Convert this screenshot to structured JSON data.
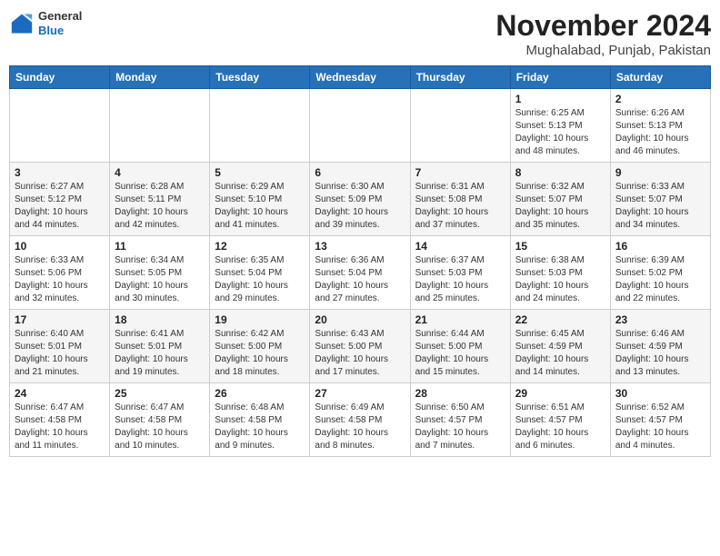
{
  "header": {
    "logo_line1": "General",
    "logo_line2": "Blue",
    "title": "November 2024",
    "subtitle": "Mughalabad, Punjab, Pakistan"
  },
  "days_of_week": [
    "Sunday",
    "Monday",
    "Tuesday",
    "Wednesday",
    "Thursday",
    "Friday",
    "Saturday"
  ],
  "weeks": [
    [
      {
        "day": "",
        "info": ""
      },
      {
        "day": "",
        "info": ""
      },
      {
        "day": "",
        "info": ""
      },
      {
        "day": "",
        "info": ""
      },
      {
        "day": "",
        "info": ""
      },
      {
        "day": "1",
        "info": "Sunrise: 6:25 AM\nSunset: 5:13 PM\nDaylight: 10 hours\nand 48 minutes."
      },
      {
        "day": "2",
        "info": "Sunrise: 6:26 AM\nSunset: 5:13 PM\nDaylight: 10 hours\nand 46 minutes."
      }
    ],
    [
      {
        "day": "3",
        "info": "Sunrise: 6:27 AM\nSunset: 5:12 PM\nDaylight: 10 hours\nand 44 minutes."
      },
      {
        "day": "4",
        "info": "Sunrise: 6:28 AM\nSunset: 5:11 PM\nDaylight: 10 hours\nand 42 minutes."
      },
      {
        "day": "5",
        "info": "Sunrise: 6:29 AM\nSunset: 5:10 PM\nDaylight: 10 hours\nand 41 minutes."
      },
      {
        "day": "6",
        "info": "Sunrise: 6:30 AM\nSunset: 5:09 PM\nDaylight: 10 hours\nand 39 minutes."
      },
      {
        "day": "7",
        "info": "Sunrise: 6:31 AM\nSunset: 5:08 PM\nDaylight: 10 hours\nand 37 minutes."
      },
      {
        "day": "8",
        "info": "Sunrise: 6:32 AM\nSunset: 5:07 PM\nDaylight: 10 hours\nand 35 minutes."
      },
      {
        "day": "9",
        "info": "Sunrise: 6:33 AM\nSunset: 5:07 PM\nDaylight: 10 hours\nand 34 minutes."
      }
    ],
    [
      {
        "day": "10",
        "info": "Sunrise: 6:33 AM\nSunset: 5:06 PM\nDaylight: 10 hours\nand 32 minutes."
      },
      {
        "day": "11",
        "info": "Sunrise: 6:34 AM\nSunset: 5:05 PM\nDaylight: 10 hours\nand 30 minutes."
      },
      {
        "day": "12",
        "info": "Sunrise: 6:35 AM\nSunset: 5:04 PM\nDaylight: 10 hours\nand 29 minutes."
      },
      {
        "day": "13",
        "info": "Sunrise: 6:36 AM\nSunset: 5:04 PM\nDaylight: 10 hours\nand 27 minutes."
      },
      {
        "day": "14",
        "info": "Sunrise: 6:37 AM\nSunset: 5:03 PM\nDaylight: 10 hours\nand 25 minutes."
      },
      {
        "day": "15",
        "info": "Sunrise: 6:38 AM\nSunset: 5:03 PM\nDaylight: 10 hours\nand 24 minutes."
      },
      {
        "day": "16",
        "info": "Sunrise: 6:39 AM\nSunset: 5:02 PM\nDaylight: 10 hours\nand 22 minutes."
      }
    ],
    [
      {
        "day": "17",
        "info": "Sunrise: 6:40 AM\nSunset: 5:01 PM\nDaylight: 10 hours\nand 21 minutes."
      },
      {
        "day": "18",
        "info": "Sunrise: 6:41 AM\nSunset: 5:01 PM\nDaylight: 10 hours\nand 19 minutes."
      },
      {
        "day": "19",
        "info": "Sunrise: 6:42 AM\nSunset: 5:00 PM\nDaylight: 10 hours\nand 18 minutes."
      },
      {
        "day": "20",
        "info": "Sunrise: 6:43 AM\nSunset: 5:00 PM\nDaylight: 10 hours\nand 17 minutes."
      },
      {
        "day": "21",
        "info": "Sunrise: 6:44 AM\nSunset: 5:00 PM\nDaylight: 10 hours\nand 15 minutes."
      },
      {
        "day": "22",
        "info": "Sunrise: 6:45 AM\nSunset: 4:59 PM\nDaylight: 10 hours\nand 14 minutes."
      },
      {
        "day": "23",
        "info": "Sunrise: 6:46 AM\nSunset: 4:59 PM\nDaylight: 10 hours\nand 13 minutes."
      }
    ],
    [
      {
        "day": "24",
        "info": "Sunrise: 6:47 AM\nSunset: 4:58 PM\nDaylight: 10 hours\nand 11 minutes."
      },
      {
        "day": "25",
        "info": "Sunrise: 6:47 AM\nSunset: 4:58 PM\nDaylight: 10 hours\nand 10 minutes."
      },
      {
        "day": "26",
        "info": "Sunrise: 6:48 AM\nSunset: 4:58 PM\nDaylight: 10 hours\nand 9 minutes."
      },
      {
        "day": "27",
        "info": "Sunrise: 6:49 AM\nSunset: 4:58 PM\nDaylight: 10 hours\nand 8 minutes."
      },
      {
        "day": "28",
        "info": "Sunrise: 6:50 AM\nSunset: 4:57 PM\nDaylight: 10 hours\nand 7 minutes."
      },
      {
        "day": "29",
        "info": "Sunrise: 6:51 AM\nSunset: 4:57 PM\nDaylight: 10 hours\nand 6 minutes."
      },
      {
        "day": "30",
        "info": "Sunrise: 6:52 AM\nSunset: 4:57 PM\nDaylight: 10 hours\nand 4 minutes."
      }
    ]
  ]
}
